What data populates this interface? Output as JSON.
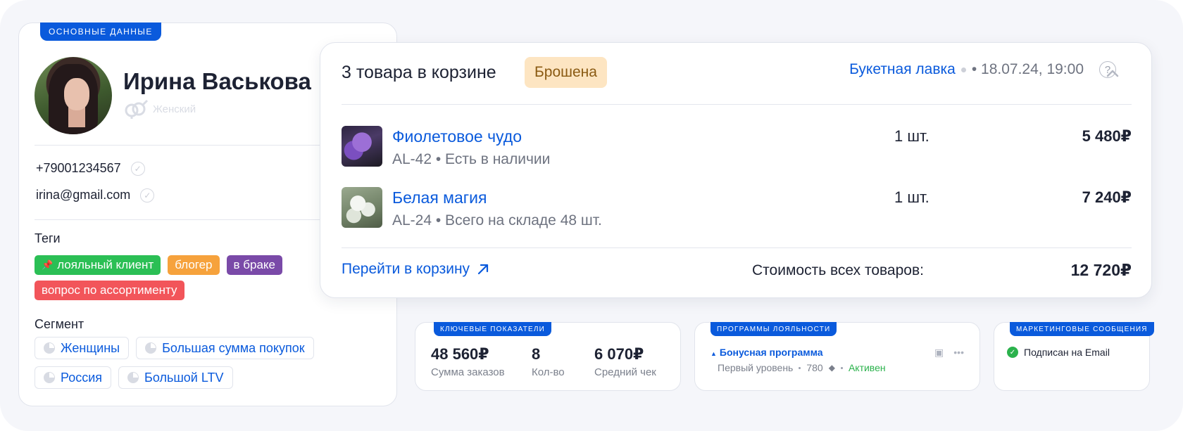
{
  "profile": {
    "ribbon": "Основные данные",
    "name": "Ирина Васькова",
    "gender": "Женский",
    "phone": "+79001234567",
    "email": "irina@gmail.com",
    "tags_title": "Теги",
    "tags": [
      {
        "label": "лояльный клиент",
        "color": "#2bbf55",
        "pinned": true
      },
      {
        "label": "блогер",
        "color": "#f6a23c"
      },
      {
        "label": "в браке",
        "color": "#7a4aa8"
      },
      {
        "label": "вопрос по ассортименту",
        "color": "#f2555a"
      }
    ],
    "segments_title": "Сегмент",
    "segments": [
      "Женщины",
      "Большая сумма покупок",
      "Россия",
      "Большой LTV"
    ]
  },
  "cart": {
    "title": "3 товара в корзине",
    "status": "Брошена",
    "shop": "Букетная лавка",
    "datetime": "• 18.07.24, 19:00",
    "help": "?",
    "items": [
      {
        "name": "Фиолетовое чудо",
        "sub": "AL-42 • Есть в наличии",
        "qty": "1 шт.",
        "price": "5 480₽"
      },
      {
        "name": "Белая магия",
        "sub": "AL-24 • Всего на складе 48 шт.",
        "qty": "1 шт.",
        "price": "7 240₽"
      }
    ],
    "go_to_cart": "Перейти в корзину",
    "total_label": "Стоимость всех товаров:",
    "total_value": "12 720₽"
  },
  "kpi": {
    "ribbon": "Ключевые показатели",
    "items": [
      {
        "value": "48 560₽",
        "label": "Сумма заказов"
      },
      {
        "value": "8",
        "label": "Кол-во"
      },
      {
        "value": "6 070₽",
        "label": "Средний чек"
      }
    ]
  },
  "loyalty": {
    "ribbon": "Программы лояльности",
    "name": "Бонусная программа",
    "level": "Первый уровень",
    "points": "780",
    "status": "Активен"
  },
  "marketing": {
    "ribbon": "Маркетинговые сообщения",
    "subscription": "Подписан на Email"
  },
  "colors": {
    "accent": "#0a5adc",
    "badge_bg": "#fde5c2",
    "active": "#2bb24c"
  }
}
